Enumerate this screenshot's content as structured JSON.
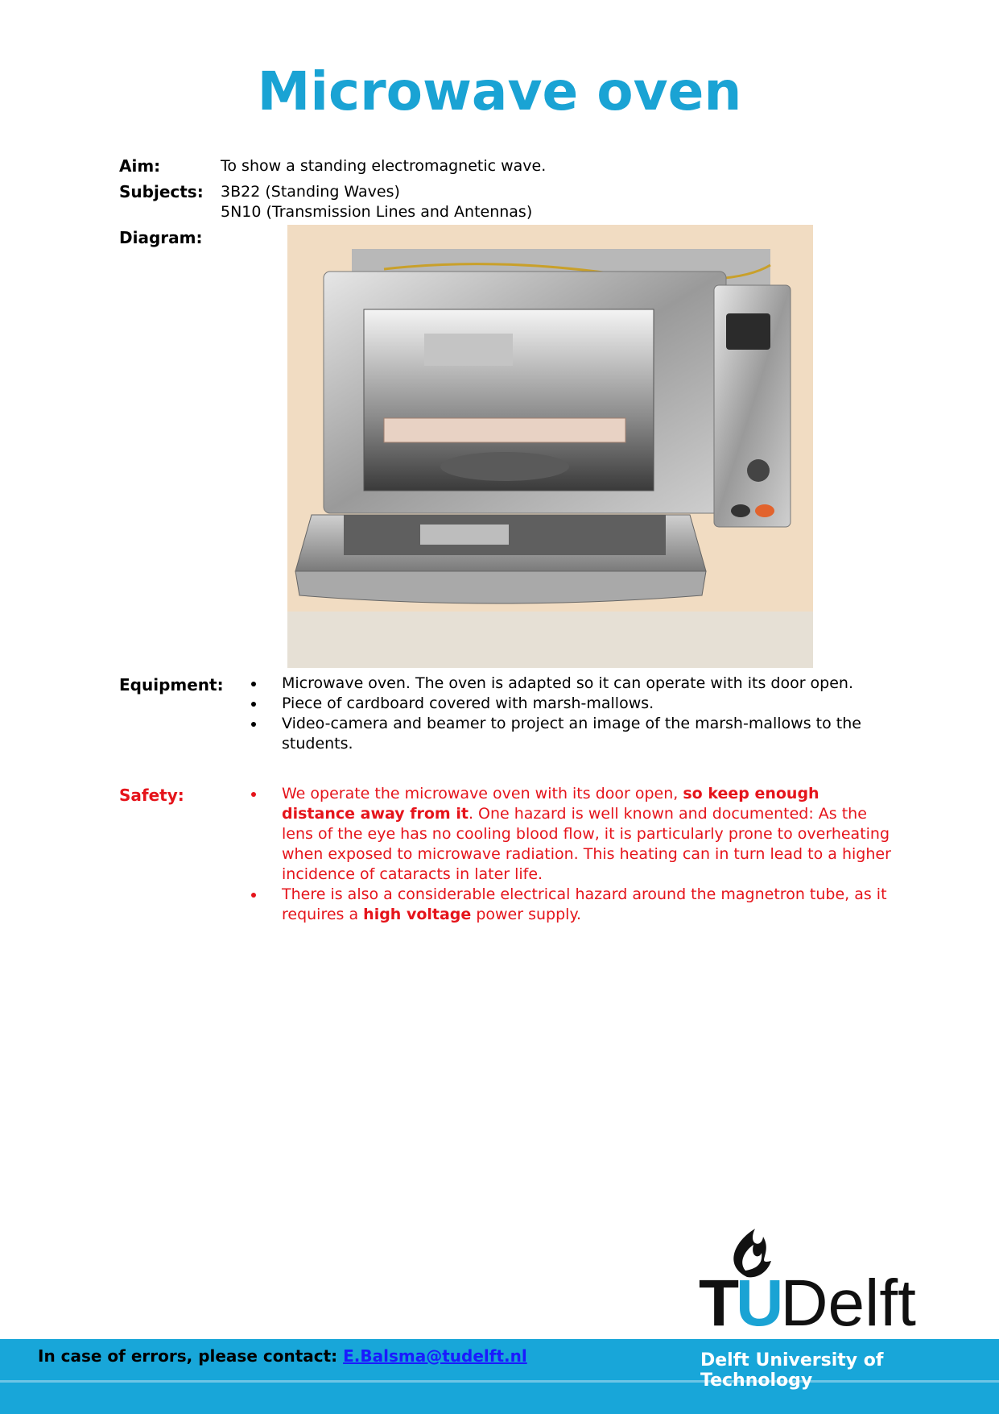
{
  "title": "Microwave oven",
  "aim": {
    "label": "Aim:",
    "value": "To show a standing electromagnetic wave."
  },
  "subjects": {
    "label": "Subjects:",
    "items": [
      "3B22 (Standing Waves)",
      "5N10 (Transmission Lines and Antennas)"
    ]
  },
  "diagram": {
    "label": "Diagram:"
  },
  "equipment": {
    "label": "Equipment:",
    "items": [
      "Microwave oven. The oven is adapted so it can operate with its door open.",
      "Piece of cardboard covered with marsh-mallows.",
      "Video-camera and beamer to project an image of the marsh-mallows to the students."
    ]
  },
  "safety": {
    "label": "Safety:",
    "item1": {
      "pre": "We operate the microwave oven with its door open, ",
      "bold": "so keep enough distance away from it",
      "post": ". One hazard is well known and documented: As the lens of the eye has no cooling blood flow, it is particularly prone to overheating when exposed to microwave radiation. This heating can in turn lead to a higher incidence of cataracts in later life."
    },
    "item2": {
      "pre": "There is also a considerable electrical hazard around the magnetron tube, as it requires a ",
      "bold": "high voltage",
      "post": " power supply."
    }
  },
  "footer": {
    "contact_label": "In case of errors, please contact: ",
    "contact_email": "E.Balsma@tudelft.nl",
    "university": "Delft University of Technology"
  },
  "logo": {
    "text_tu": "TU",
    "text_delft": "Delft",
    "icon": "flame-icon"
  },
  "colors": {
    "title": "#1aa3d4",
    "safety": "#e5141b",
    "footer": "#18a6d9"
  }
}
